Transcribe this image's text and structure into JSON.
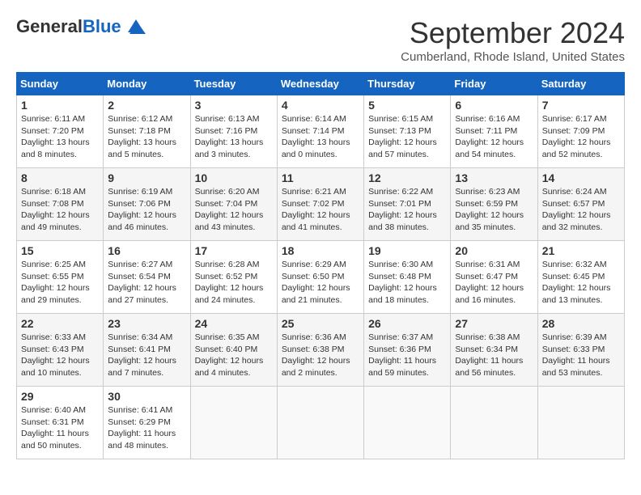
{
  "logo": {
    "general": "General",
    "blue": "Blue"
  },
  "title": "September 2024",
  "subtitle": "Cumberland, Rhode Island, United States",
  "days_header": [
    "Sunday",
    "Monday",
    "Tuesday",
    "Wednesday",
    "Thursday",
    "Friday",
    "Saturday"
  ],
  "weeks": [
    [
      {
        "day": "1",
        "sunrise": "6:11 AM",
        "sunset": "7:20 PM",
        "daylight": "13 hours and 8 minutes."
      },
      {
        "day": "2",
        "sunrise": "6:12 AM",
        "sunset": "7:18 PM",
        "daylight": "13 hours and 5 minutes."
      },
      {
        "day": "3",
        "sunrise": "6:13 AM",
        "sunset": "7:16 PM",
        "daylight": "13 hours and 3 minutes."
      },
      {
        "day": "4",
        "sunrise": "6:14 AM",
        "sunset": "7:14 PM",
        "daylight": "13 hours and 0 minutes."
      },
      {
        "day": "5",
        "sunrise": "6:15 AM",
        "sunset": "7:13 PM",
        "daylight": "12 hours and 57 minutes."
      },
      {
        "day": "6",
        "sunrise": "6:16 AM",
        "sunset": "7:11 PM",
        "daylight": "12 hours and 54 minutes."
      },
      {
        "day": "7",
        "sunrise": "6:17 AM",
        "sunset": "7:09 PM",
        "daylight": "12 hours and 52 minutes."
      }
    ],
    [
      {
        "day": "8",
        "sunrise": "6:18 AM",
        "sunset": "7:08 PM",
        "daylight": "12 hours and 49 minutes."
      },
      {
        "day": "9",
        "sunrise": "6:19 AM",
        "sunset": "7:06 PM",
        "daylight": "12 hours and 46 minutes."
      },
      {
        "day": "10",
        "sunrise": "6:20 AM",
        "sunset": "7:04 PM",
        "daylight": "12 hours and 43 minutes."
      },
      {
        "day": "11",
        "sunrise": "6:21 AM",
        "sunset": "7:02 PM",
        "daylight": "12 hours and 41 minutes."
      },
      {
        "day": "12",
        "sunrise": "6:22 AM",
        "sunset": "7:01 PM",
        "daylight": "12 hours and 38 minutes."
      },
      {
        "day": "13",
        "sunrise": "6:23 AM",
        "sunset": "6:59 PM",
        "daylight": "12 hours and 35 minutes."
      },
      {
        "day": "14",
        "sunrise": "6:24 AM",
        "sunset": "6:57 PM",
        "daylight": "12 hours and 32 minutes."
      }
    ],
    [
      {
        "day": "15",
        "sunrise": "6:25 AM",
        "sunset": "6:55 PM",
        "daylight": "12 hours and 29 minutes."
      },
      {
        "day": "16",
        "sunrise": "6:27 AM",
        "sunset": "6:54 PM",
        "daylight": "12 hours and 27 minutes."
      },
      {
        "day": "17",
        "sunrise": "6:28 AM",
        "sunset": "6:52 PM",
        "daylight": "12 hours and 24 minutes."
      },
      {
        "day": "18",
        "sunrise": "6:29 AM",
        "sunset": "6:50 PM",
        "daylight": "12 hours and 21 minutes."
      },
      {
        "day": "19",
        "sunrise": "6:30 AM",
        "sunset": "6:48 PM",
        "daylight": "12 hours and 18 minutes."
      },
      {
        "day": "20",
        "sunrise": "6:31 AM",
        "sunset": "6:47 PM",
        "daylight": "12 hours and 16 minutes."
      },
      {
        "day": "21",
        "sunrise": "6:32 AM",
        "sunset": "6:45 PM",
        "daylight": "12 hours and 13 minutes."
      }
    ],
    [
      {
        "day": "22",
        "sunrise": "6:33 AM",
        "sunset": "6:43 PM",
        "daylight": "12 hours and 10 minutes."
      },
      {
        "day": "23",
        "sunrise": "6:34 AM",
        "sunset": "6:41 PM",
        "daylight": "12 hours and 7 minutes."
      },
      {
        "day": "24",
        "sunrise": "6:35 AM",
        "sunset": "6:40 PM",
        "daylight": "12 hours and 4 minutes."
      },
      {
        "day": "25",
        "sunrise": "6:36 AM",
        "sunset": "6:38 PM",
        "daylight": "12 hours and 2 minutes."
      },
      {
        "day": "26",
        "sunrise": "6:37 AM",
        "sunset": "6:36 PM",
        "daylight": "11 hours and 59 minutes."
      },
      {
        "day": "27",
        "sunrise": "6:38 AM",
        "sunset": "6:34 PM",
        "daylight": "11 hours and 56 minutes."
      },
      {
        "day": "28",
        "sunrise": "6:39 AM",
        "sunset": "6:33 PM",
        "daylight": "11 hours and 53 minutes."
      }
    ],
    [
      {
        "day": "29",
        "sunrise": "6:40 AM",
        "sunset": "6:31 PM",
        "daylight": "11 hours and 50 minutes."
      },
      {
        "day": "30",
        "sunrise": "6:41 AM",
        "sunset": "6:29 PM",
        "daylight": "11 hours and 48 minutes."
      },
      null,
      null,
      null,
      null,
      null
    ]
  ]
}
